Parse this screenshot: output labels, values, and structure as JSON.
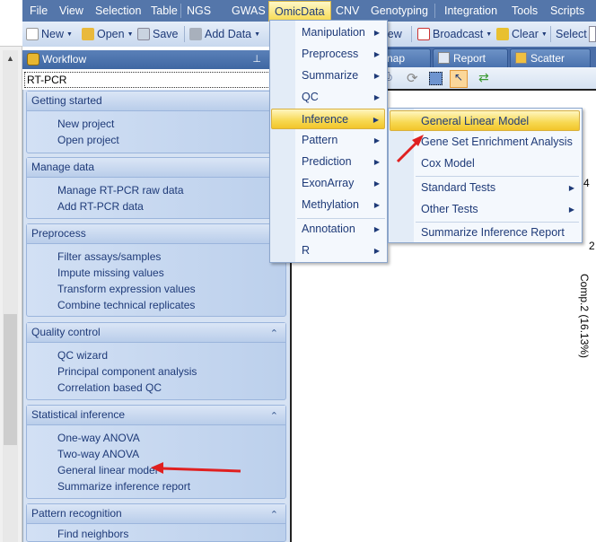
{
  "menubar": {
    "items": [
      "File",
      "View",
      "Selection",
      "Table",
      "NGS",
      "GWAS",
      "OmicData",
      "CNV",
      "Genotyping",
      "Integration",
      "Tools",
      "Scripts"
    ],
    "active": "OmicData"
  },
  "toolbar": {
    "new": "New",
    "open": "Open",
    "save": "Save",
    "add_data": "Add Data",
    "view_partial": "iew",
    "broadcast": "Broadcast",
    "clear": "Clear",
    "select": "Select"
  },
  "workflow": {
    "title": "Workflow",
    "selector_value": "RT-PCR",
    "sections": [
      {
        "title": "Getting started",
        "items": [
          "New project",
          "Open project"
        ]
      },
      {
        "title": "Manage data",
        "items": [
          "Manage RT-PCR raw data",
          "Add RT-PCR data"
        ]
      },
      {
        "title": "Preprocess",
        "items": [
          "Filter assays/samples",
          "Impute missing values",
          "Transform expression values",
          "Combine technical replicates"
        ]
      },
      {
        "title": "Quality control",
        "items": [
          "QC wizard",
          "Principal component analysis",
          "Correlation based QC"
        ]
      },
      {
        "title": "Statistical inference",
        "items": [
          "One-way ANOVA",
          "Two-way ANOVA",
          "General linear model",
          "Summarize inference report"
        ]
      },
      {
        "title": "Pattern recognition",
        "items": [
          "Find neighbors"
        ]
      }
    ]
  },
  "tabs": {
    "partial": "nap",
    "report": "Report",
    "scatter": "Scatter"
  },
  "omicdata_menu": {
    "items": [
      "Manipulation",
      "Preprocess",
      "Summarize",
      "QC",
      "Inference",
      "Pattern",
      "Prediction",
      "ExonArray",
      "Methylation",
      "Annotation",
      "R"
    ],
    "highlighted": "Inference"
  },
  "inference_submenu": {
    "items": [
      "General Linear Model",
      "Gene Set Enrichment Analysis",
      "Cox Model",
      "Standard Tests",
      "Other Tests",
      "Summarize Inference Report"
    ],
    "highlighted": "General Linear Model"
  },
  "plot": {
    "ylabel": "Comp.2 (16.13%)",
    "ticks": [
      "4",
      "2"
    ]
  },
  "colors": {
    "menubar": "#5476aa",
    "highlight": "#f7d851",
    "arrow": "#e02020"
  }
}
